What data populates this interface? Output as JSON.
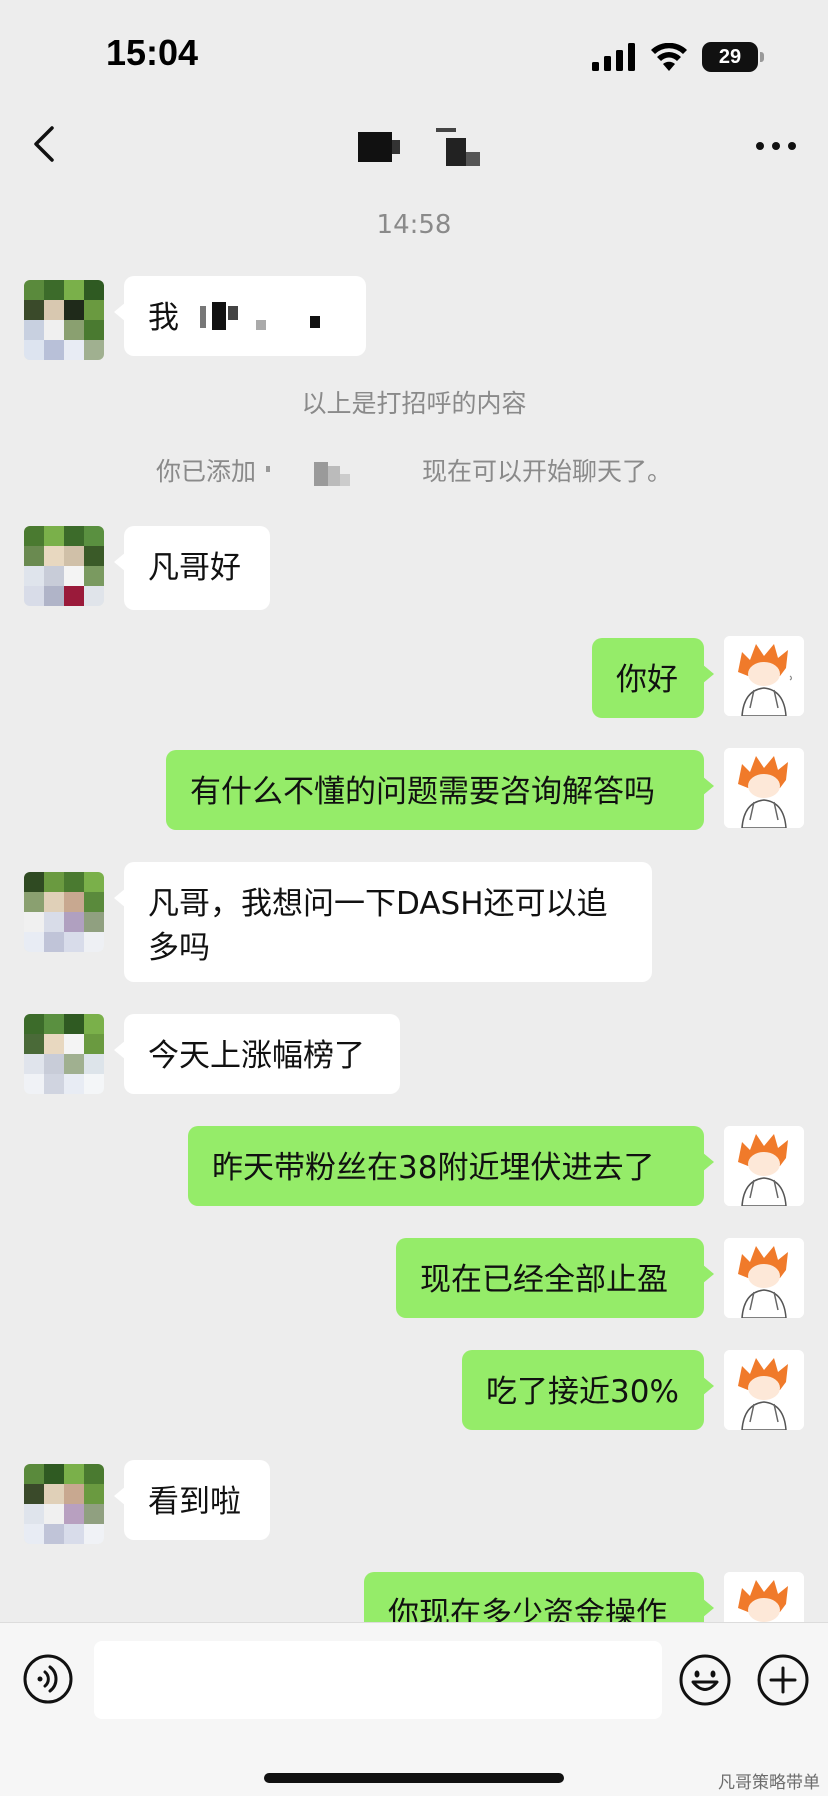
{
  "status_bar": {
    "time": "15:04",
    "battery": "29",
    "icons": [
      "cellular-signal-icon",
      "wifi-icon",
      "battery-icon"
    ]
  },
  "nav": {
    "back_icon": "chevron-left-icon",
    "more_icon": "more-horizontal-icon"
  },
  "chat": {
    "timestamp": "14:58",
    "greeting_partial": "我",
    "greeting_notice": "以上是打招呼的内容",
    "added_notice_prefix": "你已添加",
    "added_notice_suffix": "现在可以开始聊天了。",
    "messages": [
      {
        "side": "in",
        "text": "凡哥好"
      },
      {
        "side": "out",
        "text": "你好"
      },
      {
        "side": "out",
        "text": "有什么不懂的问题需要咨询解答吗"
      },
      {
        "side": "in",
        "text": "凡哥，我想问一下DASH还可以追多吗"
      },
      {
        "side": "in",
        "text": "今天上涨幅榜了"
      },
      {
        "side": "out",
        "text": "昨天带粉丝在38附近埋伏进去了"
      },
      {
        "side": "out",
        "text": "现在已经全部止盈"
      },
      {
        "side": "out",
        "text": "吃了接近30%"
      },
      {
        "side": "in",
        "text": "看到啦"
      },
      {
        "side": "out",
        "text": "你现在多少资金操作"
      }
    ]
  },
  "input_bar": {
    "voice_icon": "voice-icon",
    "emoji_icon": "emoji-icon",
    "plus_icon": "plus-icon",
    "input_value": ""
  },
  "watermark": "凡哥策略带单",
  "colors": {
    "background": "#ededed",
    "outgoing_bubble": "#95ec69",
    "incoming_bubble": "#ffffff",
    "system_text": "#8a8a8a"
  }
}
